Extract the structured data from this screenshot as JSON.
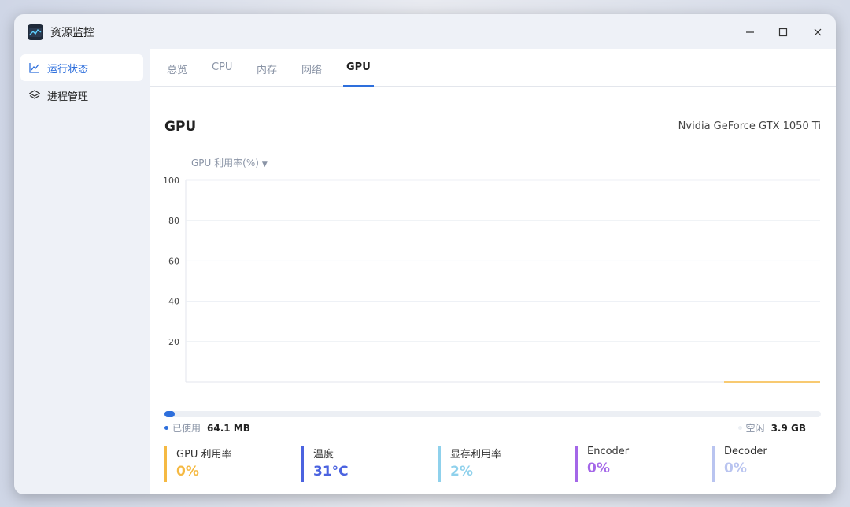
{
  "window": {
    "title": "资源监控",
    "controls": {
      "minimize": "—",
      "maximize": "☐",
      "close": "✕"
    }
  },
  "sidebar": {
    "items": [
      {
        "label": "运行状态",
        "icon": "line-chart-icon",
        "active": true
      },
      {
        "label": "进程管理",
        "icon": "layers-icon",
        "active": false
      }
    ]
  },
  "tabs": [
    {
      "label": "总览"
    },
    {
      "label": "CPU"
    },
    {
      "label": "内存"
    },
    {
      "label": "网络"
    },
    {
      "label": "GPU",
      "active": true
    }
  ],
  "gpu": {
    "section_title": "GPU",
    "model": "Nvidia GeForce GTX 1050 Ti",
    "metric_select": "GPU 利用率(%)",
    "memory": {
      "used_label": "已使用",
      "used_value": "64.1 MB",
      "free_label": "空闲",
      "free_value": "3.9 GB",
      "used_fraction": 0.016
    },
    "stats": [
      {
        "label": "GPU 利用率",
        "value": "0%",
        "color": "#f5b942"
      },
      {
        "label": "温度",
        "value": "31°C",
        "color": "#4b63e0"
      },
      {
        "label": "显存利用率",
        "value": "2%",
        "color": "#8fd1ec"
      },
      {
        "label": "Encoder",
        "value": "0%",
        "color": "#a467e8"
      },
      {
        "label": "Decoder",
        "value": "0%",
        "color": "#b9c4f0"
      }
    ]
  },
  "chart_data": {
    "type": "line",
    "title": "",
    "xlabel": "",
    "ylabel": "",
    "ylim": [
      0,
      100
    ],
    "yticks": [
      "100",
      "80",
      "60",
      "40",
      "20"
    ],
    "grid": true,
    "series": [
      {
        "values": [
          0,
          0,
          0,
          0,
          0,
          0,
          0
        ],
        "color": "#f5b942"
      }
    ]
  },
  "colors": {
    "accent": "#2e6fdc",
    "utilization": "#f5b942"
  }
}
